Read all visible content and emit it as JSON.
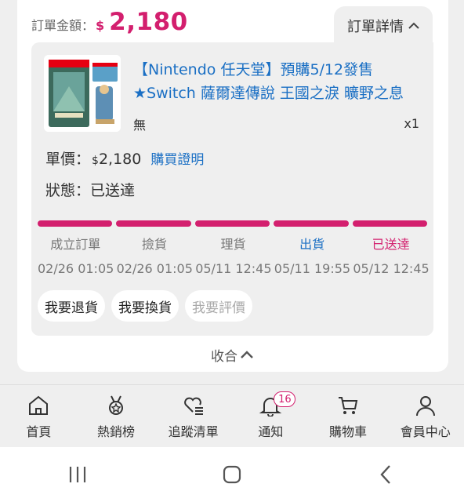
{
  "order": {
    "total_label": "訂單金額：",
    "currency": "$",
    "total_amount": "2,180",
    "detail_tab_label": "訂單詳情"
  },
  "product": {
    "title_line1": "【Nintendo 任天堂】預購5/12發售",
    "title_line2": "★Switch 薩爾達傳說 王國之淚 曠野之息",
    "variant": "無",
    "quantity": "x1"
  },
  "price": {
    "label": "單價：",
    "currency": "$",
    "value": "2,180",
    "proof_link": "購買證明"
  },
  "status": {
    "label": "狀態：",
    "value": "已送達"
  },
  "tracking": {
    "steps": [
      {
        "name": "成立訂單",
        "time": "02/26 01:05"
      },
      {
        "name": "撿貨",
        "time": "02/26 01:05"
      },
      {
        "name": "理貨",
        "time": "05/11 12:45"
      },
      {
        "name": "出貨",
        "time": "05/11 19:55"
      },
      {
        "name": "已送達",
        "time": "05/12 12:45"
      }
    ],
    "progress_fraction": 1.0
  },
  "actions": {
    "return_label": "我要退貨",
    "exchange_label": "我要換貨",
    "review_label": "我要評價"
  },
  "collapse_label": "收合",
  "bottom_nav": {
    "items": [
      {
        "label": "首頁",
        "icon": "home-icon"
      },
      {
        "label": "熱銷榜",
        "icon": "medal-icon"
      },
      {
        "label": "追蹤清單",
        "icon": "heart-list-icon"
      },
      {
        "label": "通知",
        "icon": "bell-icon",
        "badge": "16"
      },
      {
        "label": "購物車",
        "icon": "cart-icon"
      },
      {
        "label": "會員中心",
        "icon": "user-icon"
      }
    ]
  },
  "colors": {
    "accent": "#d31f6e",
    "link": "#1a6fc4",
    "panel": "#efefef"
  }
}
